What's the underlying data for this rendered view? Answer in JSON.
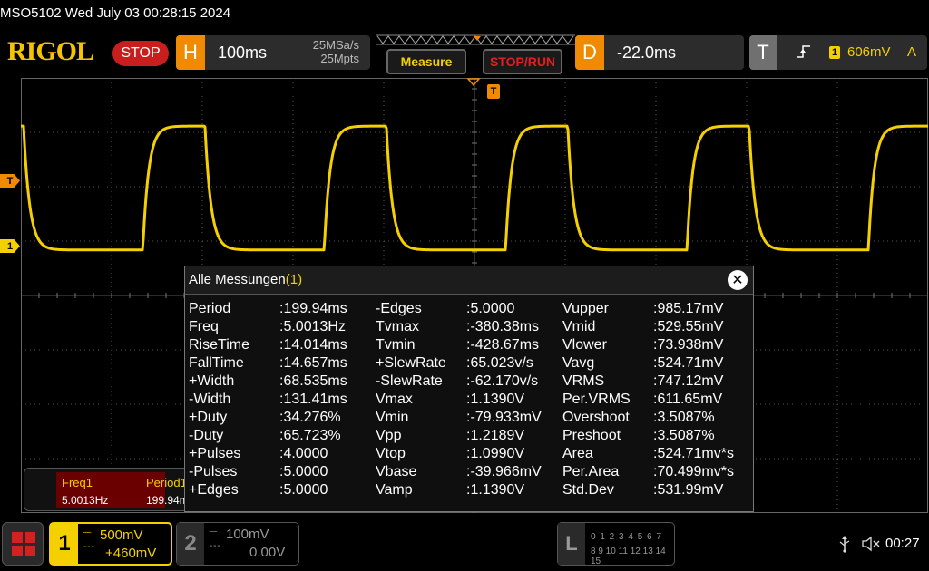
{
  "title": "MSO5102  Wed July 03 00:28:15 2024",
  "brand": "RIGOL",
  "run_state": "STOP",
  "horizontal": {
    "letter": "H",
    "timebase": "100ms",
    "sample_rate": "25MSa/s",
    "memory_depth": "25Mpts"
  },
  "buttons": {
    "measure": "Measure",
    "stop_run": "STOP/RUN"
  },
  "delay": {
    "letter": "D",
    "value": "-22.0ms"
  },
  "trigger": {
    "letter": "T",
    "channel": "1",
    "level": "606mV",
    "mode": "A",
    "marker": "T"
  },
  "channel_marker": "1",
  "colors": {
    "ch1": "#f5d000",
    "accent": "#f08a00",
    "stop": "#c81e1e"
  },
  "waveform": {
    "high_v": 1.099,
    "low_v": -0.04,
    "period_ms": 199.94,
    "plus_width_ms": 68.535,
    "rise_ms": 14.014,
    "fall_ms": 14.657,
    "first_falling_edge_ms": 3,
    "time_per_div_ms": 100,
    "volts_per_div": 0.5
  },
  "freq_panel": {
    "freq_label": "Freq1",
    "freq_value": "5.0013Hz",
    "period_label": "Period1",
    "period_value": "199.94ms"
  },
  "dialog": {
    "title": "Alle Messungen",
    "title_channel": "(1)",
    "columns": [
      [
        {
          "label": "Period",
          "value": ":199.94ms"
        },
        {
          "label": "Freq",
          "value": ":5.0013Hz"
        },
        {
          "label": "RiseTime",
          "value": ":14.014ms"
        },
        {
          "label": "FallTime",
          "value": ":14.657ms"
        },
        {
          "label": "+Width",
          "value": ":68.535ms"
        },
        {
          "label": "-Width",
          "value": ":131.41ms"
        },
        {
          "label": "+Duty",
          "value": ":34.276%"
        },
        {
          "label": "-Duty",
          "value": ":65.723%"
        },
        {
          "label": "+Pulses",
          "value": ":4.0000"
        },
        {
          "label": "-Pulses",
          "value": ":5.0000"
        },
        {
          "label": "+Edges",
          "value": ":5.0000"
        }
      ],
      [
        {
          "label": "-Edges",
          "value": ":5.0000"
        },
        {
          "label": "Tvmax",
          "value": ":-380.38ms"
        },
        {
          "label": "Tvmin",
          "value": ":-428.67ms"
        },
        {
          "label": "+SlewRate",
          "value": ":65.023v/s"
        },
        {
          "label": "-SlewRate",
          "value": ":-62.170v/s"
        },
        {
          "label": "Vmax",
          "value": ":1.1390V"
        },
        {
          "label": "Vmin",
          "value": ":-79.933mV"
        },
        {
          "label": "Vpp",
          "value": ":1.2189V"
        },
        {
          "label": "Vtop",
          "value": ":1.0990V"
        },
        {
          "label": "Vbase",
          "value": ":-39.966mV"
        },
        {
          "label": "Vamp",
          "value": ":1.1390V"
        }
      ],
      [
        {
          "label": "Vupper",
          "value": ":985.17mV"
        },
        {
          "label": "Vmid",
          "value": ":529.55mV"
        },
        {
          "label": "Vlower",
          "value": ":73.938mV"
        },
        {
          "label": "Vavg",
          "value": ":524.71mV"
        },
        {
          "label": "VRMS",
          "value": ":747.12mV"
        },
        {
          "label": "Per.VRMS",
          "value": ":611.65mV"
        },
        {
          "label": "Overshoot",
          "value": ":3.5087%"
        },
        {
          "label": "Preshoot",
          "value": ":3.5087%"
        },
        {
          "label": "Area",
          "value": ":524.71mv*s"
        },
        {
          "label": "Per.Area",
          "value": ":70.499mv*s"
        },
        {
          "label": "Std.Dev",
          "value": ":531.99mV"
        }
      ]
    ]
  },
  "bottom": {
    "ch1": {
      "num": "1",
      "scale": "500mV",
      "offset": "+460mV"
    },
    "ch2": {
      "num": "2",
      "scale": "100mV",
      "offset": "0.00V"
    },
    "la": {
      "letter": "L",
      "row1": "0 1 2 3  4 5 6 7",
      "row2": "8 9 10 11 12 13 14 15"
    },
    "clock": "00:27"
  },
  "icons": {
    "menu": "menu-grid-icon",
    "usb": "usb-icon",
    "mute": "speaker-mute-icon",
    "close": "close-icon",
    "trigger_edge": "rising-edge-icon"
  }
}
